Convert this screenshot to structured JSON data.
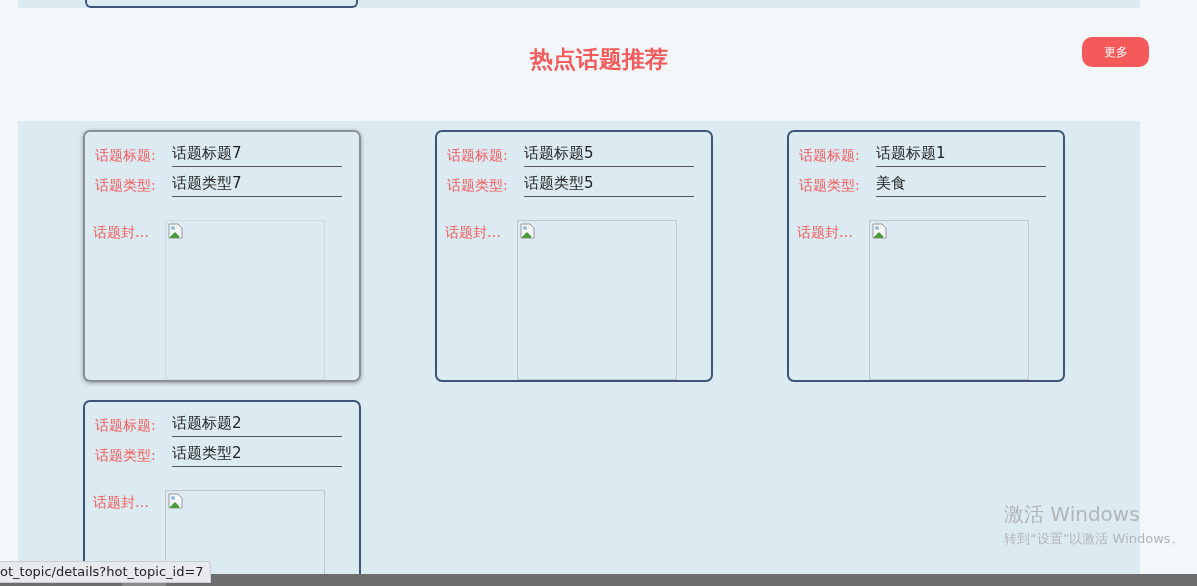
{
  "header": {
    "title": "热点话题推荐",
    "more_button": "更多"
  },
  "cards": [
    {
      "title_label": "话题标题:",
      "title": "话题标题7",
      "type_label": "话题类型:",
      "type": "话题类型7",
      "cover_label": "话题封…",
      "hovered": true
    },
    {
      "title_label": "话题标题:",
      "title": "话题标题5",
      "type_label": "话题类型:",
      "type": "话题类型5",
      "cover_label": "话题封…",
      "hovered": false
    },
    {
      "title_label": "话题标题:",
      "title": "话题标题1",
      "type_label": "话题类型:",
      "type": "美食",
      "cover_label": "话题封…",
      "hovered": false
    },
    {
      "title_label": "话题标题:",
      "title": "话题标题2",
      "type_label": "话题类型:",
      "type": "话题类型2",
      "cover_label": "话题封…",
      "hovered": false
    }
  ],
  "status_url": "ot_topic/details?hot_topic_id=7",
  "activation": {
    "title": "激活 Windows",
    "hint": "转到“设置”以激活 Windows。"
  }
}
